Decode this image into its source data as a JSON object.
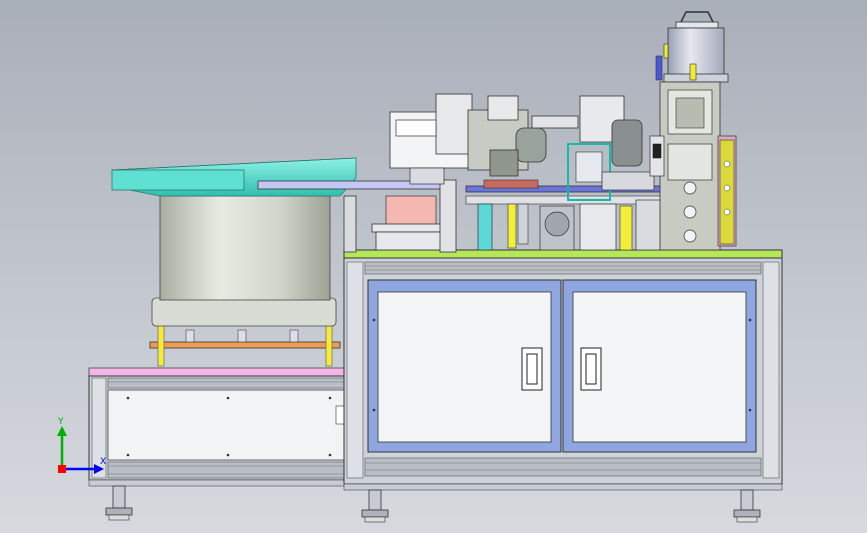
{
  "viewport": {
    "background_top": "#a9afb9",
    "background_bottom": "#d6d9de"
  },
  "triad": {
    "y_label": "Y",
    "x_label": "X",
    "x_color": "#0000ff",
    "y_color": "#00b000",
    "z_color": "#ff0000"
  },
  "model": {
    "frame_color": "#ced3da",
    "door_border_color": "#8fa6e0",
    "table_top_color": "#b6e65a",
    "feeder_tray_color": "#4cd8c8",
    "feeder_drum_color": "#d9dcd4",
    "hopper_color": "#c8ccd8",
    "accent_yellow": "#f2ee3a",
    "accent_pink": "#e7a3a0"
  }
}
